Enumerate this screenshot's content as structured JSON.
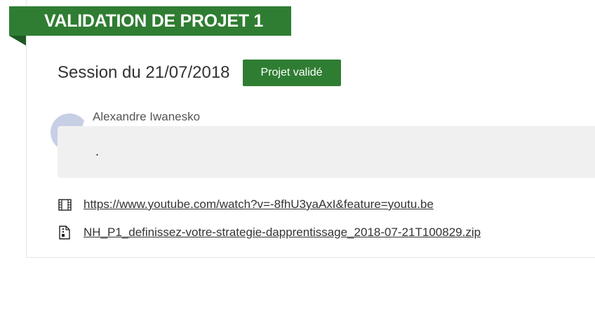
{
  "header": {
    "title": "VALIDATION DE PROJET 1"
  },
  "session": {
    "title": "Session du 21/07/2018",
    "status_label": "Projet validé"
  },
  "comment": {
    "author": "Alexandre Iwanesko",
    "text": "."
  },
  "attachments": [
    {
      "icon": "film-icon",
      "label": "https://www.youtube.com/watch?v=-8fhU3yaAxI&feature=youtu.be"
    },
    {
      "icon": "file-zip-icon",
      "label": "NH_P1_definissez-votre-strategie-dapprentissage_2018-07-21T100829.zip"
    }
  ],
  "colors": {
    "accent": "#2f7d32",
    "accent_dark": "#1f5a22",
    "comment_bg": "#f0f0f0"
  }
}
